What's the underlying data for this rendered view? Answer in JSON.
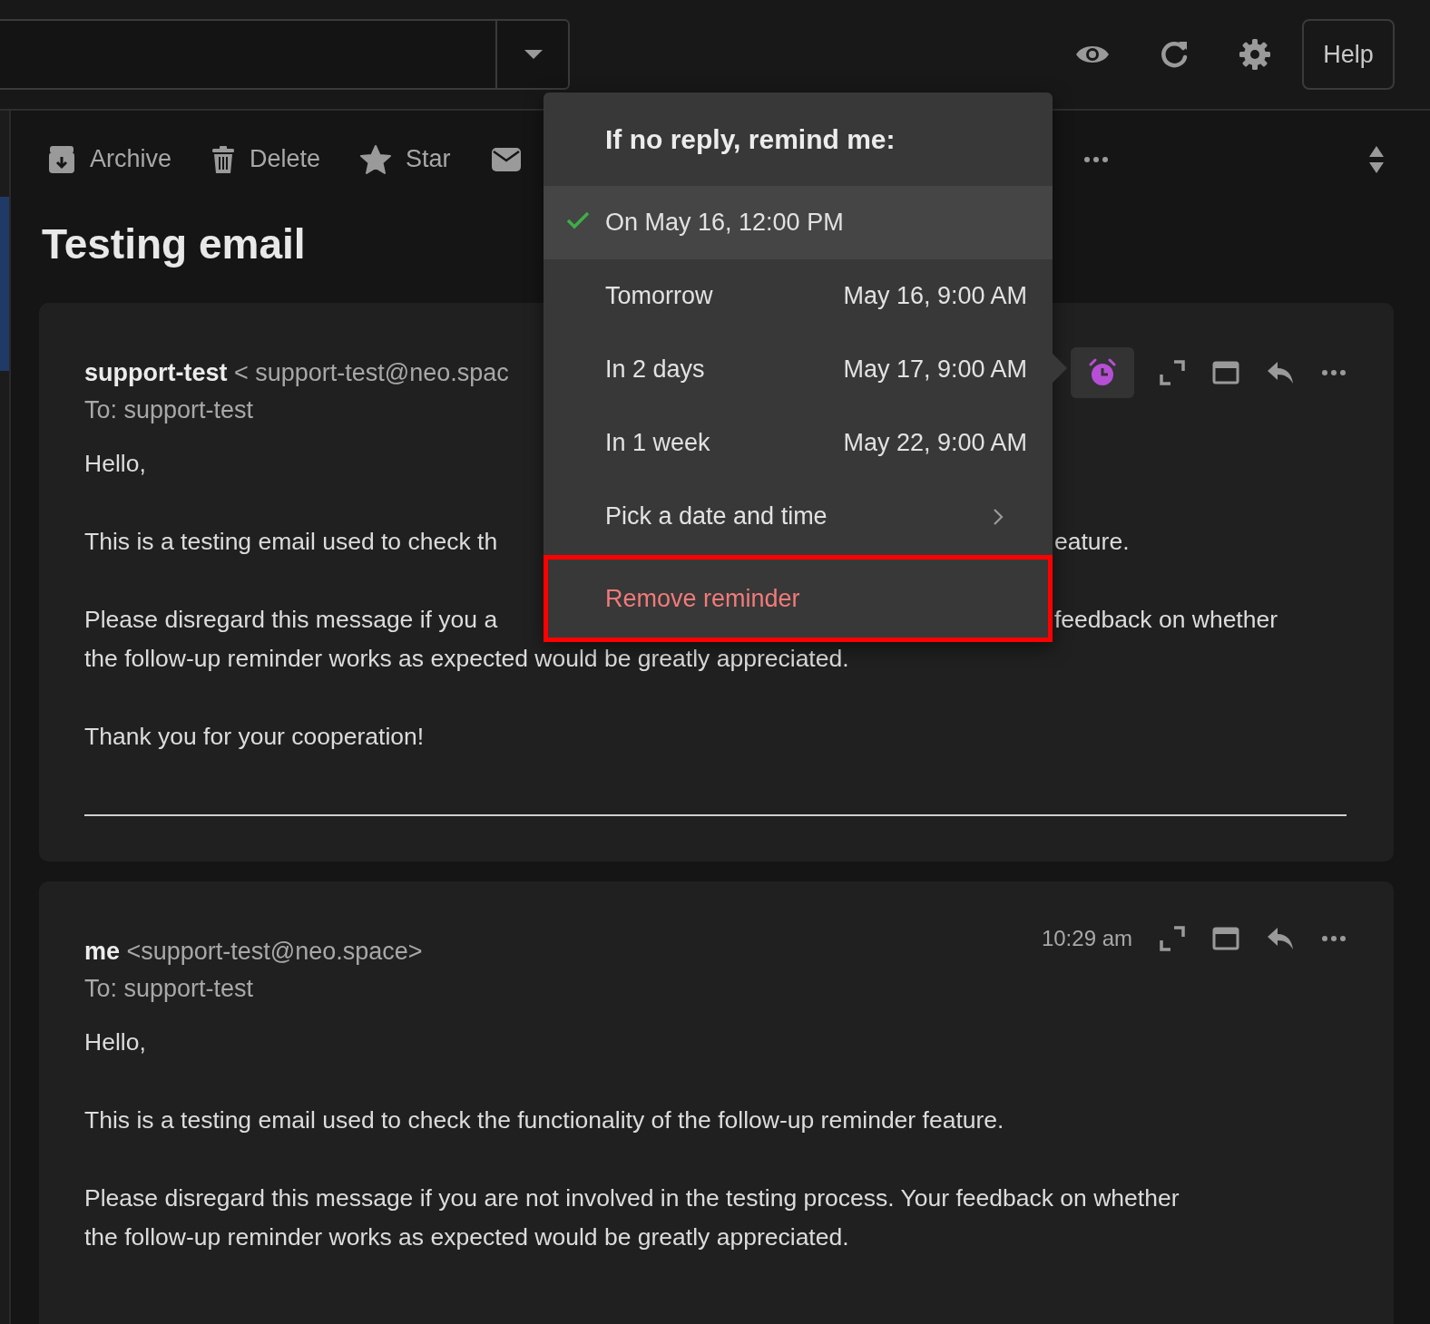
{
  "top_bar": {
    "help_button": "Help"
  },
  "toolbar": {
    "actions": [
      {
        "kind": "archive",
        "label": "Archive"
      },
      {
        "kind": "delete",
        "label": "Delete"
      },
      {
        "kind": "star",
        "label": "Star"
      },
      {
        "kind": "mail"
      }
    ]
  },
  "subject": "Testing email",
  "messages": [
    {
      "sender_name": "support-test",
      "sender_address": "< support-test@neo.spac",
      "to": "To: support-test",
      "reminder_active": true,
      "paragraphs": [
        {
          "lines": [
            {
              "left": "Hello,"
            }
          ]
        },
        {
          "lines": [
            {
              "left": "This is a testing email used to check th",
              "right": "eature."
            }
          ]
        },
        {
          "lines": [
            {
              "left": "Please disregard this message if you a",
              "right": "feedback on whether"
            },
            {
              "left": "the follow-up reminder works as expected would be greatly appreciated."
            }
          ]
        },
        {
          "lines": [
            {
              "left": "Thank you for your cooperation!"
            }
          ]
        }
      ],
      "signature_rule": true
    },
    {
      "sender_name": "me",
      "sender_address": "<support-test@neo.space>",
      "to": "To: support-test",
      "time": "10:29 am",
      "reminder_active": false,
      "paragraphs": [
        {
          "lines": [
            {
              "left": "Hello,"
            }
          ]
        },
        {
          "lines": [
            {
              "left": "This is a testing email used to check the functionality of the follow-up reminder feature."
            }
          ]
        },
        {
          "lines": [
            {
              "left": "Please disregard this message if you are not involved in the testing process. Your feedback on whether"
            },
            {
              "left": "the follow-up reminder works as expected would be greatly appreciated."
            }
          ]
        }
      ],
      "signature_rule": false
    }
  ],
  "reminder_menu": {
    "title": "If no reply, remind me:",
    "options": [
      {
        "kind": "option",
        "label": "On May 16, 12:00 PM",
        "selected": true,
        "highlighted": false
      },
      {
        "kind": "option",
        "label": "Tomorrow",
        "date": "May 16, 9:00 AM",
        "selected": false,
        "highlighted": false
      },
      {
        "kind": "option",
        "label": "In 2 days",
        "date": "May 17, 9:00 AM",
        "selected": false,
        "highlighted": false
      },
      {
        "kind": "option",
        "label": "In 1 week",
        "date": "May 22, 9:00 AM",
        "selected": false,
        "highlighted": false
      },
      {
        "kind": "submenu",
        "label": "Pick a date and time",
        "selected": false,
        "highlighted": false
      },
      {
        "kind": "remove",
        "label": "Remove reminder",
        "selected": false,
        "highlighted": true
      }
    ]
  }
}
